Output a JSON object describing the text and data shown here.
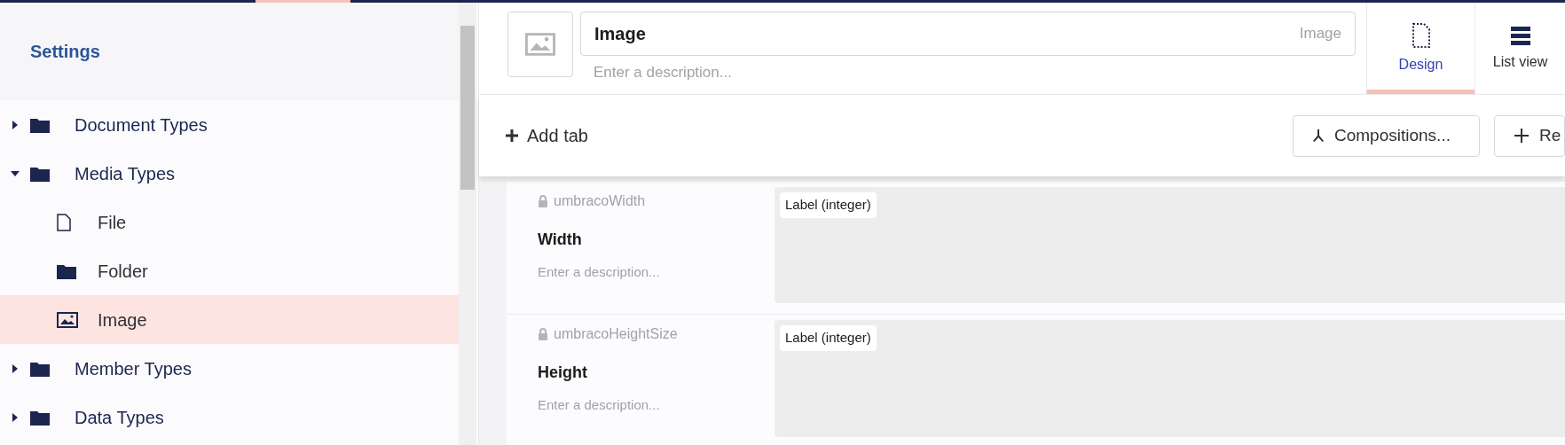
{
  "sidebar": {
    "title": "Settings",
    "tree": [
      {
        "label": "Document Types",
        "kind": "folder",
        "expanded": false,
        "selected": false
      },
      {
        "label": "Media Types",
        "kind": "folder",
        "expanded": true,
        "selected": false,
        "children": [
          {
            "label": "File",
            "kind": "file",
            "selected": false
          },
          {
            "label": "Folder",
            "kind": "folder",
            "selected": false
          },
          {
            "label": "Image",
            "kind": "image",
            "selected": true
          }
        ]
      },
      {
        "label": "Member Types",
        "kind": "folder",
        "expanded": false,
        "selected": false
      },
      {
        "label": "Data Types",
        "kind": "folder",
        "expanded": false,
        "selected": false
      }
    ]
  },
  "editor": {
    "name": {
      "value": "Image",
      "alias": "Image",
      "description_placeholder": "Enter a description..."
    },
    "views": [
      {
        "label": "Design",
        "kind": "design",
        "selected": true
      },
      {
        "label": "List view",
        "kind": "list",
        "selected": false
      }
    ],
    "add_tab": "Add tab",
    "buttons": [
      {
        "label": "Compositions...",
        "kind": "compositions"
      },
      {
        "label": "Re",
        "kind": "reorder"
      }
    ],
    "properties": [
      {
        "alias": "umbracoWidth",
        "name": "Width",
        "description_placeholder": "Enter a description...",
        "editor": "Label (integer)"
      },
      {
        "alias": "umbracoHeightSize",
        "name": "Height",
        "description_placeholder": "Enter a description...",
        "editor": "Label (integer)"
      }
    ]
  }
}
